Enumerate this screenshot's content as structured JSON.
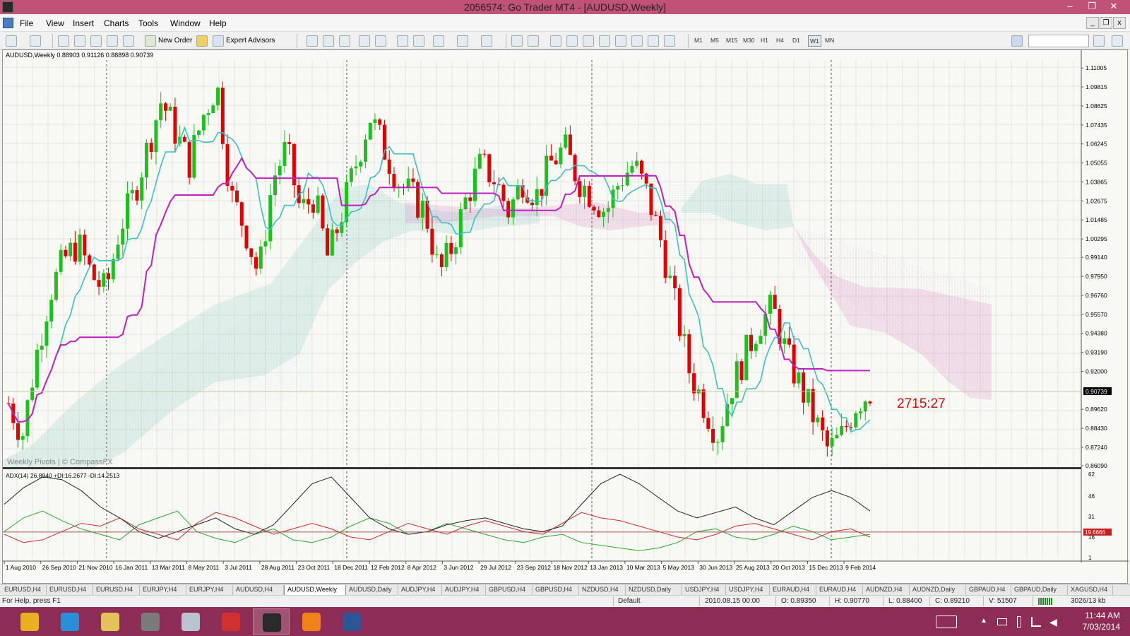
{
  "window": {
    "title": "2056574: Go Trader MT4 - [AUDUSD,Weekly]",
    "controls": [
      "–",
      "❐",
      "✕"
    ]
  },
  "menu": [
    "File",
    "View",
    "Insert",
    "Charts",
    "Tools",
    "Window",
    "Help"
  ],
  "toolbar": {
    "new_order": "New Order",
    "expert_advisors": "Expert Advisors",
    "timeframes": [
      "M1",
      "M5",
      "M15",
      "M30",
      "H1",
      "H4",
      "D1",
      "W1",
      "MN"
    ],
    "active_timeframe": "W1"
  },
  "chart": {
    "info": "AUDUSD,Weekly  0.88903 0.91126 0.88898 0.90739",
    "watermark": "Weekly Pivots | © CompassFX",
    "timer": "2715:27",
    "current_price": "0.90739",
    "price_ticks": [
      "1.11005",
      "1.09815",
      "1.08625",
      "1.07435",
      "1.06245",
      "1.05055",
      "1.03865",
      "1.02675",
      "1.01485",
      "1.00295",
      "0.99140",
      "0.97950",
      "0.96760",
      "0.95570",
      "0.94380",
      "0.93190",
      "0.92000",
      "0.90739",
      "0.89620",
      "0.88430",
      "0.87240",
      "0.86090"
    ],
    "adx_info": "ADX(14) 26.8940  +DI:16.2677  -DI:14.2513",
    "adx_ticks": [
      "62",
      "46",
      "31",
      "19.6666",
      "16",
      "1"
    ],
    "dates": [
      "1 Aug 2010",
      "26 Sep 2010",
      "21 Nov 2010",
      "16 Jan 2011",
      "13 Mar 2011",
      "8 May 2011",
      "3 Jul 2011",
      "28 Aug 2011",
      "23 Oct 2011",
      "18 Dec 2011",
      "12 Feb 2012",
      "8 Apr 2012",
      "3 Jun 2012",
      "29 Jul 2012",
      "23 Sep 2012",
      "18 Nov 2012",
      "13 Jan 2013",
      "10 Mar 2013",
      "5 May 2013",
      "30 Jun 2013",
      "25 Aug 2013",
      "20 Oct 2013",
      "15 Dec 2013",
      "9 Feb 2014"
    ]
  },
  "chart_data": {
    "type": "candlestick",
    "symbol": "AUDUSD",
    "timeframe": "Weekly",
    "ylim": [
      0.86,
      1.115
    ],
    "close_path": [
      0.9,
      0.88,
      0.93,
      0.97,
      0.99,
      1.0,
      0.98,
      0.97,
      1.01,
      1.03,
      1.06,
      1.09,
      1.07,
      1.05,
      1.08,
      1.1,
      1.03,
      1.01,
      0.98,
      1.04,
      1.06,
      1.02,
      1.03,
      0.99,
      1.02,
      1.05,
      1.08,
      1.06,
      1.04,
      1.03,
      1.02,
      0.98,
      1.0,
      1.03,
      1.05,
      1.04,
      1.02,
      1.04,
      1.03,
      1.05,
      1.06,
      1.04,
      1.03,
      1.02,
      1.04,
      1.05,
      1.03,
      1.0,
      0.96,
      0.92,
      0.9,
      0.88,
      0.91,
      0.93,
      0.95,
      0.96,
      0.93,
      0.91,
      0.89,
      0.87,
      0.88,
      0.9,
      0.907
    ],
    "adx_series": [
      {
        "name": "ADX",
        "color": "#222222"
      },
      {
        "name": "+DI",
        "color": "#2aa82a"
      },
      {
        "name": "-DI",
        "color": "#cc2a2a"
      }
    ],
    "colors": {
      "bull": "#1fbf1f",
      "bear": "#e00000",
      "tenkan": "#3cc0c0",
      "kijun": "#c020c0",
      "cloud_bull": "#3aa8a8",
      "cloud_bear": "#c050b0"
    }
  },
  "tabs": [
    "EURUSD,H4",
    "EURUSD,H4",
    "EURUSD,H4",
    "EURJPY,H4",
    "EURJPY,H4",
    "AUDUSD,H4",
    "AUDUSD,Weekly",
    "AUDUSD,Daily",
    "AUDJPY,H4",
    "AUDJPY,H4",
    "GBPUSD,H4",
    "GBPUSD,H4",
    "NZDUSD,H4",
    "NZDUSD,Daily",
    "USDJPY,H4",
    "USDJPY,H4",
    "EURAUD,H4",
    "EURAUD,H4",
    "AUDNZD,H4",
    "AUDNZD,Daily",
    "GBPAUD,H4",
    "GBPAUD,Daily",
    "XAGUSD,H4"
  ],
  "active_tab": "AUDUSD,Weekly",
  "status": {
    "help": "For Help, press F1",
    "profile": "Default",
    "datetime": "2010.08.15 00:00",
    "open": "O: 0.89350",
    "high": "H: 0.90770",
    "low": "L: 0.88400",
    "close": "C: 0.89210",
    "volume": "V: 51507",
    "traffic": "3026/13 kb"
  },
  "taskbar": {
    "apps": [
      {
        "name": "chrome-icon",
        "color": "#e8b020"
      },
      {
        "name": "ie-icon",
        "color": "#2b8fd8"
      },
      {
        "name": "explorer-icon",
        "color": "#e3c25a"
      },
      {
        "name": "tool-icon",
        "color": "#7a7a7a"
      },
      {
        "name": "calculator-icon",
        "color": "#b8c4d0"
      },
      {
        "name": "paint-icon",
        "color": "#d03030"
      },
      {
        "name": "mt4-icon",
        "color": "#2a2a2a"
      },
      {
        "name": "orange-app-icon",
        "color": "#f08018"
      },
      {
        "name": "word-icon",
        "color": "#2b5797"
      }
    ],
    "time": "11:44 AM",
    "date": "7/03/2014"
  }
}
